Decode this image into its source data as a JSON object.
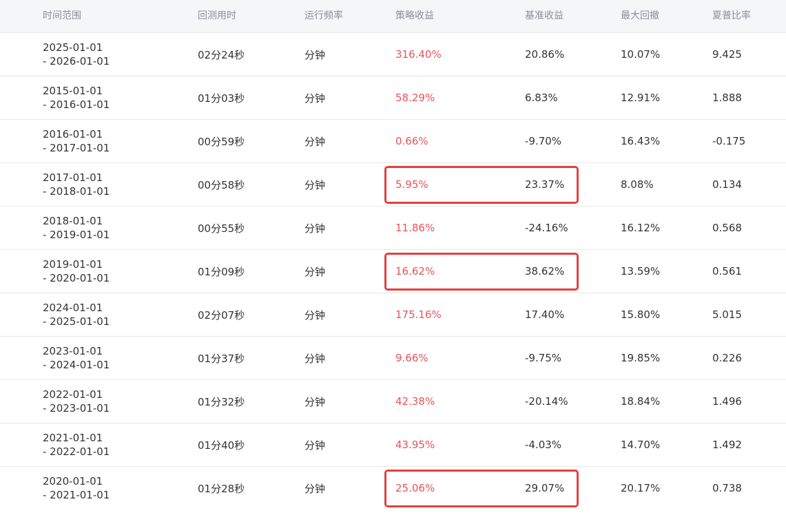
{
  "headers": [
    "时间范围",
    "回测用时",
    "运行频率",
    "策略收益",
    "基准收益",
    "最大回撤",
    "夏普比率"
  ],
  "rows": [
    {
      "range_start": "2025-01-01",
      "range_end": "- 2026-01-01",
      "duration": "02分24秒",
      "frequency": "分钟",
      "strategy_return": "316.40%",
      "benchmark_return": "20.86%",
      "max_drawdown": "10.07%",
      "sharpe": "9.425",
      "highlighted": false
    },
    {
      "range_start": "2015-01-01",
      "range_end": "- 2016-01-01",
      "duration": "01分03秒",
      "frequency": "分钟",
      "strategy_return": "58.29%",
      "benchmark_return": "6.83%",
      "max_drawdown": "12.91%",
      "sharpe": "1.888",
      "highlighted": false
    },
    {
      "range_start": "2016-01-01",
      "range_end": "- 2017-01-01",
      "duration": "00分59秒",
      "frequency": "分钟",
      "strategy_return": "0.66%",
      "benchmark_return": "-9.70%",
      "max_drawdown": "16.43%",
      "sharpe": "-0.175",
      "highlighted": false
    },
    {
      "range_start": "2017-01-01",
      "range_end": "- 2018-01-01",
      "duration": "00分58秒",
      "frequency": "分钟",
      "strategy_return": "5.95%",
      "benchmark_return": "23.37%",
      "max_drawdown": "8.08%",
      "sharpe": "0.134",
      "highlighted": true
    },
    {
      "range_start": "2018-01-01",
      "range_end": "- 2019-01-01",
      "duration": "00分55秒",
      "frequency": "分钟",
      "strategy_return": "11.86%",
      "benchmark_return": "-24.16%",
      "max_drawdown": "16.12%",
      "sharpe": "0.568",
      "highlighted": false
    },
    {
      "range_start": "2019-01-01",
      "range_end": "- 2020-01-01",
      "duration": "01分09秒",
      "frequency": "分钟",
      "strategy_return": "16.62%",
      "benchmark_return": "38.62%",
      "max_drawdown": "13.59%",
      "sharpe": "0.561",
      "highlighted": true
    },
    {
      "range_start": "2024-01-01",
      "range_end": "- 2025-01-01",
      "duration": "02分07秒",
      "frequency": "分钟",
      "strategy_return": "175.16%",
      "benchmark_return": "17.40%",
      "max_drawdown": "15.80%",
      "sharpe": "5.015",
      "highlighted": false
    },
    {
      "range_start": "2023-01-01",
      "range_end": "- 2024-01-01",
      "duration": "01分37秒",
      "frequency": "分钟",
      "strategy_return": "9.66%",
      "benchmark_return": "-9.75%",
      "max_drawdown": "19.85%",
      "sharpe": "0.226",
      "highlighted": false
    },
    {
      "range_start": "2022-01-01",
      "range_end": "- 2023-01-01",
      "duration": "01分32秒",
      "frequency": "分钟",
      "strategy_return": "42.38%",
      "benchmark_return": "-20.14%",
      "max_drawdown": "18.84%",
      "sharpe": "1.496",
      "highlighted": false
    },
    {
      "range_start": "2021-01-01",
      "range_end": "- 2022-01-01",
      "duration": "01分40秒",
      "frequency": "分钟",
      "strategy_return": "43.95%",
      "benchmark_return": "-4.03%",
      "max_drawdown": "14.70%",
      "sharpe": "1.492",
      "highlighted": false
    },
    {
      "range_start": "2020-01-01",
      "range_end": "- 2021-01-01",
      "duration": "01分28秒",
      "frequency": "分钟",
      "strategy_return": "25.06%",
      "benchmark_return": "29.07%",
      "max_drawdown": "20.17%",
      "sharpe": "0.738",
      "highlighted": true
    }
  ],
  "colors": {
    "strategy_return": "#e8535a",
    "highlight_border": "#e3403d",
    "header_bg": "#f5f6f7",
    "header_text": "#8a8f99"
  }
}
